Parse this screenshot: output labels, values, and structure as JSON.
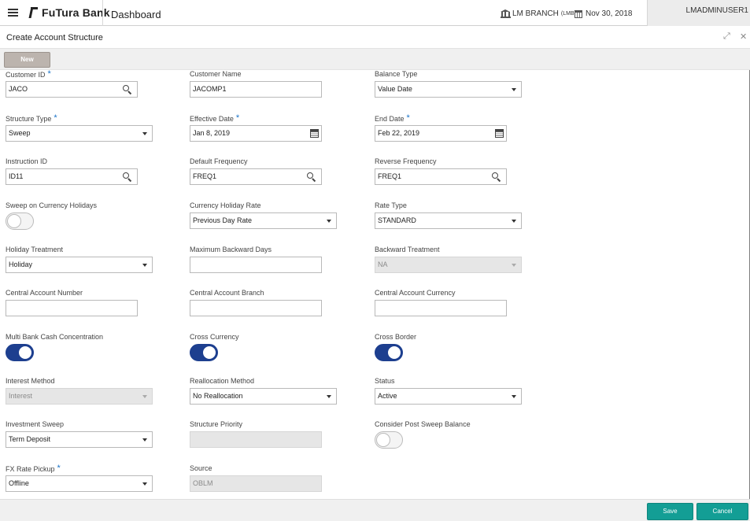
{
  "header": {
    "brand": "FuTura Bank",
    "title": "Dashboard",
    "branch": "LM BRANCH",
    "branch_code": "(LMB)",
    "date": "Nov 30, 2018",
    "user": "LMADMINUSER1"
  },
  "screen": {
    "title": "Create Account Structure",
    "new_label": "New"
  },
  "fields": {
    "customer_id": {
      "label": "Customer ID",
      "value": "JACO"
    },
    "customer_name": {
      "label": "Customer Name",
      "value": "JACOMP1"
    },
    "balance_type": {
      "label": "Balance Type",
      "value": "Value Date"
    },
    "structure_type": {
      "label": "Structure Type",
      "value": "Sweep"
    },
    "effective_date": {
      "label": "Effective Date",
      "value": "Jan 8, 2019"
    },
    "end_date": {
      "label": "End Date",
      "value": "Feb 22, 2019"
    },
    "instruction_id": {
      "label": "Instruction ID",
      "value": "ID11"
    },
    "default_frequency": {
      "label": "Default Frequency",
      "value": "FREQ1"
    },
    "reverse_frequency": {
      "label": "Reverse Frequency",
      "value": "FREQ1"
    },
    "sweep_currency_holidays": {
      "label": "Sweep on Currency Holidays",
      "on": false
    },
    "currency_holiday_rate": {
      "label": "Currency Holiday Rate",
      "value": "Previous Day Rate"
    },
    "rate_type": {
      "label": "Rate Type",
      "value": "STANDARD"
    },
    "holiday_treatment": {
      "label": "Holiday Treatment",
      "value": "Holiday"
    },
    "max_backward_days": {
      "label": "Maximum Backward Days",
      "value": ""
    },
    "backward_treatment": {
      "label": "Backward Treatment",
      "value": "NA"
    },
    "central_account_number": {
      "label": "Central Account Number",
      "value": ""
    },
    "central_account_branch": {
      "label": "Central Account Branch",
      "value": ""
    },
    "central_account_currency": {
      "label": "Central Account Currency",
      "value": ""
    },
    "multi_bank_cash": {
      "label": "Multi Bank Cash Concentration",
      "on": true
    },
    "cross_currency": {
      "label": "Cross Currency",
      "on": true
    },
    "cross_border": {
      "label": "Cross Border",
      "on": true
    },
    "interest_method": {
      "label": "Interest Method",
      "value": "Interest"
    },
    "reallocation_method": {
      "label": "Reallocation Method",
      "value": "No Reallocation"
    },
    "status": {
      "label": "Status",
      "value": "Active"
    },
    "investment_sweep": {
      "label": "Investment Sweep",
      "value": "Term Deposit"
    },
    "structure_priority": {
      "label": "Structure Priority",
      "value": ""
    },
    "consider_post_sweep": {
      "label": "Consider Post Sweep Balance",
      "on": false
    },
    "fx_rate_pickup": {
      "label": "FX Rate Pickup",
      "value": "Offline"
    },
    "source": {
      "label": "Source",
      "value": "OBLM"
    }
  },
  "required_mark": "*",
  "footer": {
    "save_label": "Save",
    "cancel_label": "Cancel"
  },
  "colors": {
    "toggle_on": "#1d3f8f",
    "button_teal": "#139e95",
    "required_star": "#1a73c8"
  }
}
